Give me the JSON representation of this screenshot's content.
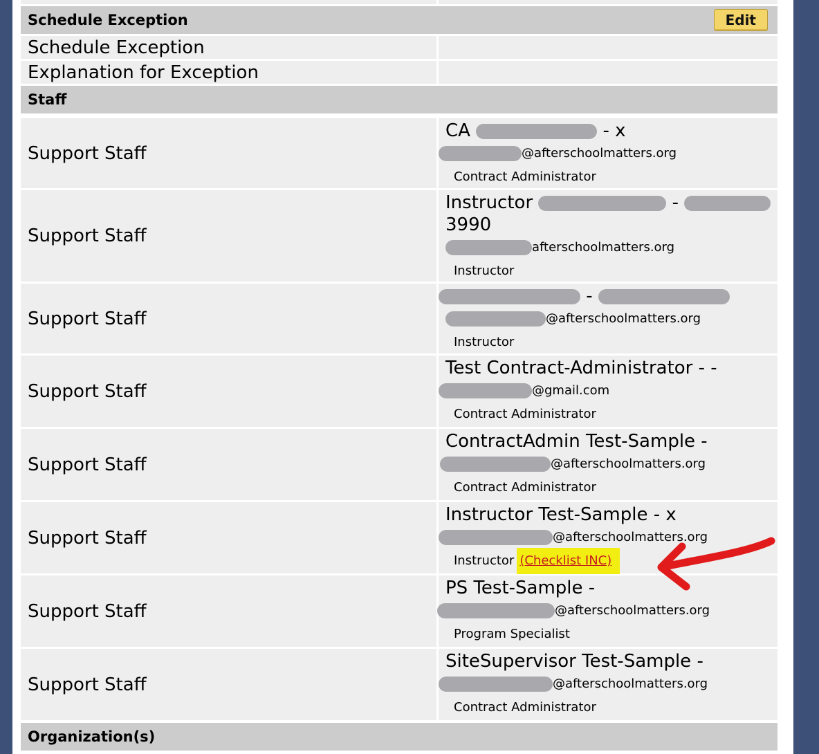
{
  "schedule_exception": {
    "header": "Schedule Exception",
    "edit_label": "Edit",
    "rows": [
      {
        "label": "Schedule Exception",
        "value": ""
      },
      {
        "label": "Explanation for Exception",
        "value": ""
      }
    ]
  },
  "staff": {
    "header": "Staff",
    "rows": [
      {
        "label": "Support Staff",
        "name_prefix": "CA",
        "name_suffix": "- x",
        "email_domain": "@afterschoolmatters.org",
        "role": "Contract Administrator"
      },
      {
        "label": "Support Staff",
        "name_prefix": "Instructor",
        "name_suffix": "-",
        "name_line2": "3990",
        "email_domain": "afterschoolmatters.org",
        "role": "Instructor"
      },
      {
        "label": "Support Staff",
        "name_prefix": "",
        "name_suffix": "-",
        "email_domain": "@afterschoolmatters.org",
        "role": "Instructor"
      },
      {
        "label": "Support Staff",
        "name_prefix": "Test Contract-Administrator - -",
        "email_domain": "@gmail.com",
        "role": "Contract Administrator"
      },
      {
        "label": "Support Staff",
        "name_prefix": "ContractAdmin Test-Sample -",
        "email_domain": "@afterschoolmatters.org",
        "role": "Contract Administrator"
      },
      {
        "label": "Support Staff",
        "name_prefix": "Instructor Test-Sample - x",
        "email_domain": "@afterschoolmatters.org",
        "role": "Instructor",
        "checklist": "(Checklist INC)"
      },
      {
        "label": "Support Staff",
        "name_prefix": "PS Test-Sample -",
        "email_domain": "@afterschoolmatters.org",
        "role": "Program Specialist"
      },
      {
        "label": "Support Staff",
        "name_prefix": "SiteSupervisor Test-Sample -",
        "email_domain": "@afterschoolmatters.org",
        "role": "Contract Administrator"
      }
    ]
  },
  "organizations": {
    "header": "Organization(s)"
  },
  "colors": {
    "highlight": "#f2ee12",
    "arrow": "#e11b1b",
    "link": "#c51f1f",
    "edit_button": "#f3d56a"
  }
}
